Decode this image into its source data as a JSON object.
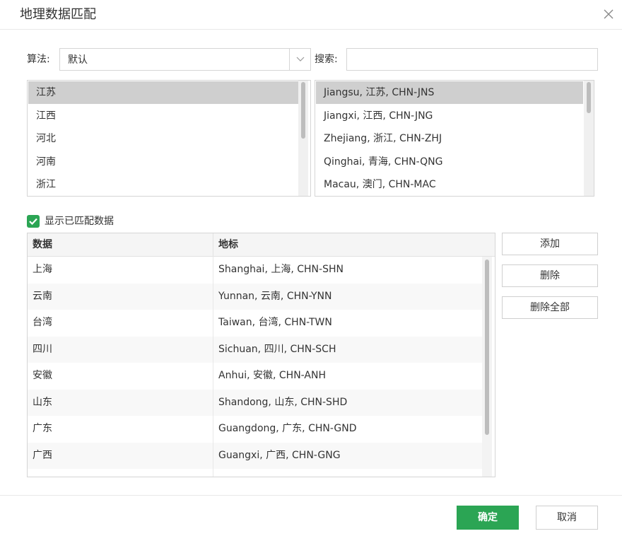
{
  "dialog": {
    "title": "地理数据匹配"
  },
  "algorithm": {
    "label": "算法:",
    "value": "默认"
  },
  "search": {
    "label": "搜索:",
    "value": "",
    "placeholder": ""
  },
  "data_list": {
    "items": [
      "江苏",
      "江西",
      "河北",
      "河南",
      "浙江"
    ],
    "selected_index": 0
  },
  "landmark_list": {
    "items": [
      "Jiangsu, 江苏, CHN-JNS",
      "Jiangxi, 江西, CHN-JNG",
      "Zhejiang, 浙江, CHN-ZHJ",
      "Qinghai, 青海, CHN-QNG",
      "Macau, 澳门, CHN-MAC"
    ],
    "selected_index": 0
  },
  "show_matched": {
    "label": "显示已匹配数据",
    "checked": true
  },
  "table": {
    "columns": [
      "数据",
      "地标"
    ],
    "rows": [
      [
        "上海",
        "Shanghai, 上海, CHN-SHN"
      ],
      [
        "云南",
        "Yunnan, 云南, CHN-YNN"
      ],
      [
        "台湾",
        "Taiwan, 台湾, CHN-TWN"
      ],
      [
        "四川",
        "Sichuan, 四川, CHN-SCH"
      ],
      [
        "安徽",
        "Anhui, 安徽, CHN-ANH"
      ],
      [
        "山东",
        "Shandong, 山东, CHN-SHD"
      ],
      [
        "广东",
        "Guangdong, 广东, CHN-GND"
      ],
      [
        "广西",
        "Guangxi, 广西, CHN-GNG"
      ]
    ]
  },
  "actions": {
    "add": "添加",
    "delete": "删除",
    "delete_all": "删除全部"
  },
  "footer": {
    "ok": "确定",
    "cancel": "取消"
  },
  "colors": {
    "accent": "#2ba554",
    "selected_row": "#cfcfcf",
    "border": "#d5d5d5"
  }
}
